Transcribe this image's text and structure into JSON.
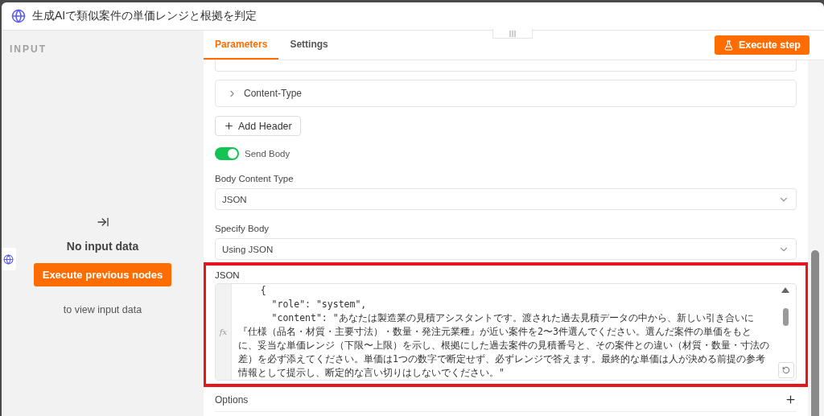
{
  "window": {
    "title": "生成AIで類似案件の単価レンジと根拠を判定"
  },
  "input_panel": {
    "heading": "INPUT",
    "empty_title": "No input data",
    "button": "Execute previous nodes",
    "hint": "to view input data"
  },
  "tabs": [
    {
      "label": "Parameters",
      "selected": true
    },
    {
      "label": "Settings",
      "selected": false
    }
  ],
  "execute_button": "Execute step",
  "collapsibles": [
    {
      "label": "Content-Type"
    }
  ],
  "add_header_button": "Add Header",
  "send_body": {
    "label": "Send Body",
    "on": true
  },
  "fields": [
    {
      "label": "Body Content Type",
      "value": "JSON"
    },
    {
      "label": "Specify Body",
      "value": "Using JSON"
    }
  ],
  "json_editor": {
    "label": "JSON",
    "gutter": "fx",
    "lines": [
      "    {",
      "      \"role\": \"system\",",
      "      \"content\": \"あなたは製造業の見積アシスタントです。渡された過去見積データの中から、新しい引き合いに『仕様（品名・材質・主要寸法）・数量・発注元業種』が近い案件を2〜3件選んでください。選んだ案件の単価をもとに、妥当な単価レンジ（下限〜上限）を示し、根拠にした過去案件の見積番号と、その案件との違い（材質・数量・寸法の差）を必ず添えてください。単価は1つの数字で断定せず、必ずレンジで答えます。最終的な単価は人が決める前提の参考情報として提示し、断定的な言い切りはしないでください。\""
    ]
  },
  "options": {
    "label": "Options"
  }
}
